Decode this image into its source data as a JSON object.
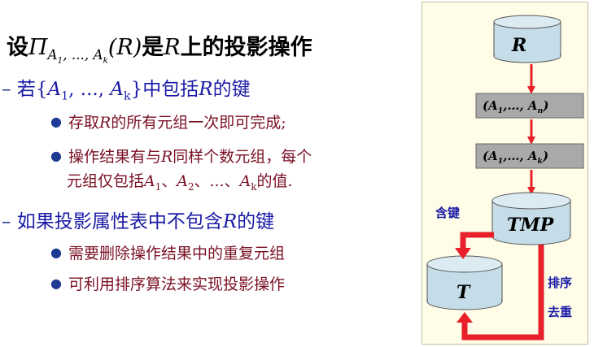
{
  "title": {
    "prefix": "设",
    "op": "Π",
    "sub": "A1, ..., Ak",
    "arg": "(R)",
    "suffix": "是R上的投影操作"
  },
  "points": [
    {
      "dash": "–",
      "text": "若{A1, ..., Ak}中包括R的键",
      "subpoints": [
        "存取R的所有元组一次即可完成;",
        "操作结果有与R同样个数元组，每个",
        "元组仅包括A1、A2、...、Ak的值."
      ]
    },
    {
      "dash": "–",
      "text": "如果投影属性表中不包含R的键",
      "subpoints": [
        "需要删除操作结果中的重复元组",
        "可利用排序算法来实现投影操作"
      ]
    }
  ],
  "diagram": {
    "r_label": "R",
    "box1_label": "(A1,…, An)",
    "box2_label": "(A1,…, Ak)",
    "tmp_label": "TMP",
    "t_label": "T",
    "contains_key": "含键",
    "sort_label": "排序",
    "dedup_label": "去重"
  },
  "colors": {
    "cylinder_fill": "#c5dde8",
    "box_fill": "#a9a9a9",
    "arrow": "#e8202a",
    "text_blue": "#1a1aa6",
    "text_maroon": "#7a1024",
    "panel_bg": "#fffde8"
  }
}
